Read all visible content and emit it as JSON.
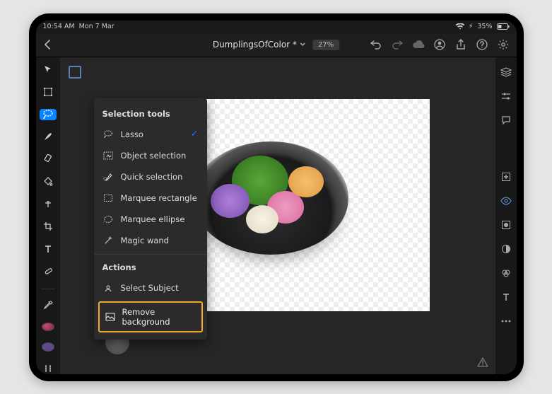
{
  "status": {
    "time": "10:54 AM",
    "date": "Mon 7 Mar",
    "battery": "35%"
  },
  "header": {
    "doc_name": "DumplingsOfColor *",
    "zoom": "27%"
  },
  "flyout": {
    "section1_title": "Selection tools",
    "items": [
      {
        "label": "Lasso",
        "checked": true
      },
      {
        "label": "Object selection",
        "checked": false
      },
      {
        "label": "Quick selection",
        "checked": false
      },
      {
        "label": "Marquee rectangle",
        "checked": false
      },
      {
        "label": "Marquee ellipse",
        "checked": false
      },
      {
        "label": "Magic wand",
        "checked": false
      }
    ],
    "section2_title": "Actions",
    "actions": [
      {
        "label": "Select Subject"
      },
      {
        "label": "Remove background"
      }
    ]
  }
}
